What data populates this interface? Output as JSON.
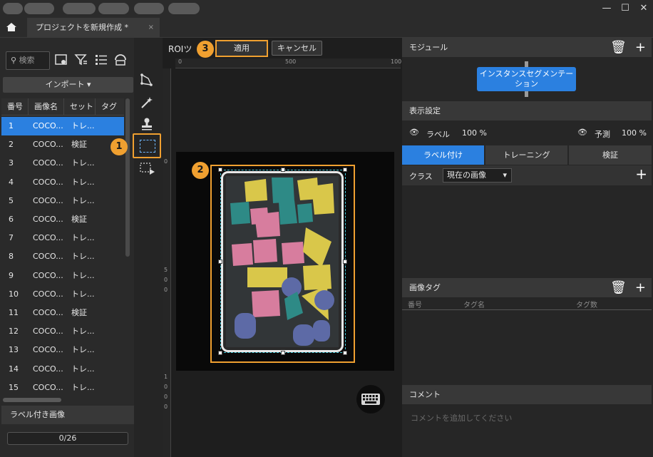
{
  "tab": {
    "title": "プロジェクトを新規作成 *",
    "close": "×"
  },
  "window": {
    "min": "—",
    "max": "☐",
    "close": "✕"
  },
  "left": {
    "search_placeholder": "検索",
    "import_label": "インポート",
    "columns": [
      "番号",
      "画像名",
      "セット",
      "タグ"
    ],
    "rows": [
      {
        "no": "1",
        "name": "COCO...",
        "set": "トレ..."
      },
      {
        "no": "2",
        "name": "COCO...",
        "set": "検証"
      },
      {
        "no": "3",
        "name": "COCO...",
        "set": "トレ..."
      },
      {
        "no": "4",
        "name": "COCO...",
        "set": "トレ..."
      },
      {
        "no": "5",
        "name": "COCO...",
        "set": "トレ..."
      },
      {
        "no": "6",
        "name": "COCO...",
        "set": "検証"
      },
      {
        "no": "7",
        "name": "COCO...",
        "set": "トレ..."
      },
      {
        "no": "8",
        "name": "COCO...",
        "set": "トレ..."
      },
      {
        "no": "9",
        "name": "COCO...",
        "set": "トレ..."
      },
      {
        "no": "10",
        "name": "COCO...",
        "set": "トレ..."
      },
      {
        "no": "11",
        "name": "COCO...",
        "set": "検証"
      },
      {
        "no": "12",
        "name": "COCO...",
        "set": "トレ..."
      },
      {
        "no": "13",
        "name": "COCO...",
        "set": "トレ..."
      },
      {
        "no": "14",
        "name": "COCO...",
        "set": "トレ..."
      },
      {
        "no": "15",
        "name": "COCO...",
        "set": "トレ..."
      }
    ],
    "labeled_images": "ラベル付き画像",
    "count": "0/26"
  },
  "canvas": {
    "roi_label": "ROIツ",
    "apply": "適用",
    "cancel": "キャンセル",
    "ruler_top": [
      "0",
      "500",
      "100"
    ],
    "ruler_left": [
      "0",
      "5",
      "0",
      "0",
      "1",
      "0",
      "0",
      "0"
    ]
  },
  "badges": [
    "1",
    "2",
    "3"
  ],
  "right": {
    "module_title": "モジュール",
    "module_node": "インスタンスセグメンテーション",
    "display_title": "表示設定",
    "label_toggle": "ラベル",
    "label_pct": "100 %",
    "predict_toggle": "予測",
    "predict_pct": "100 %",
    "tabs": [
      "ラベル付け",
      "トレーニング",
      "検証"
    ],
    "class_label": "クラス",
    "class_value": "現在の画像",
    "image_tag_title": "画像タグ",
    "tag_columns": [
      "番号",
      "タグ名",
      "タグ数"
    ],
    "comment_title": "コメント",
    "comment_placeholder": "コメントを追加してください"
  },
  "colors": {
    "accent": "#2b80e0",
    "highlight": "#f0a030"
  }
}
